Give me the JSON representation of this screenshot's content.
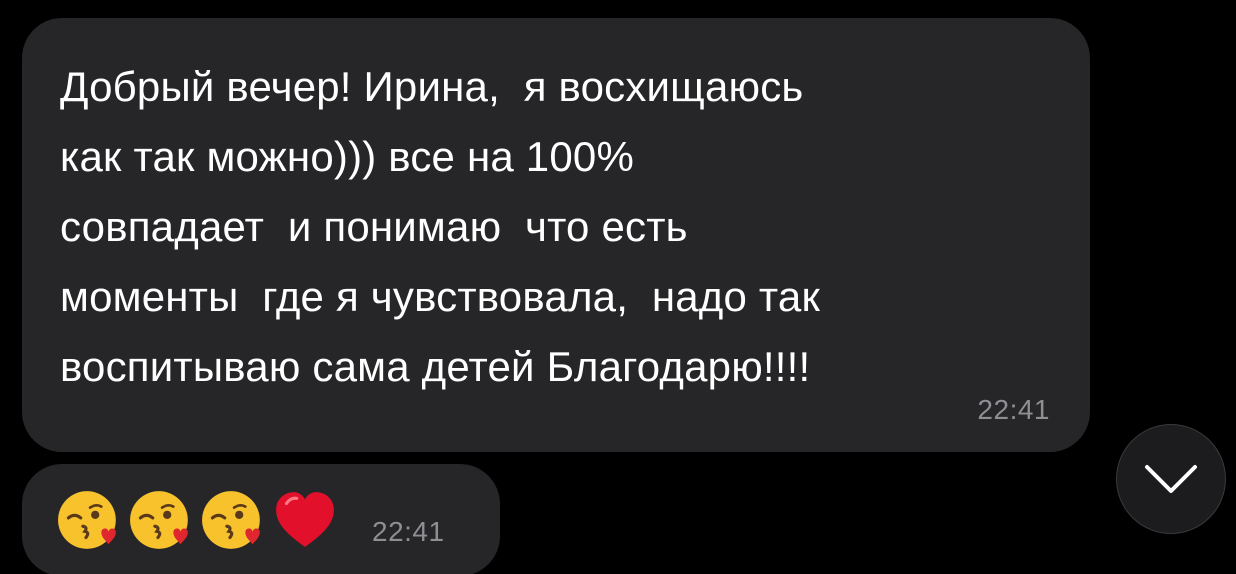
{
  "messages": [
    {
      "text": "Добрый вечер! Ирина,  я восхищаюсь\nкак так можно))) все на 100%\nсовпадает  и понимаю  что есть\nмоменты  где я чувствовала,  надо так\nвоспитываю сама детей Благодарю!!!!",
      "time": "22:41"
    },
    {
      "emojis": [
        "kissing-face-with-heart-icon",
        "kissing-face-with-heart-icon",
        "kissing-face-with-heart-icon",
        "red-heart-icon"
      ],
      "time": "22:41"
    }
  ],
  "scroll_button": {
    "icon": "chevron-down-icon"
  },
  "colors": {
    "background": "#000000",
    "bubble": "#262628",
    "text": "#ffffff",
    "timestamp": "#8e8e93"
  }
}
